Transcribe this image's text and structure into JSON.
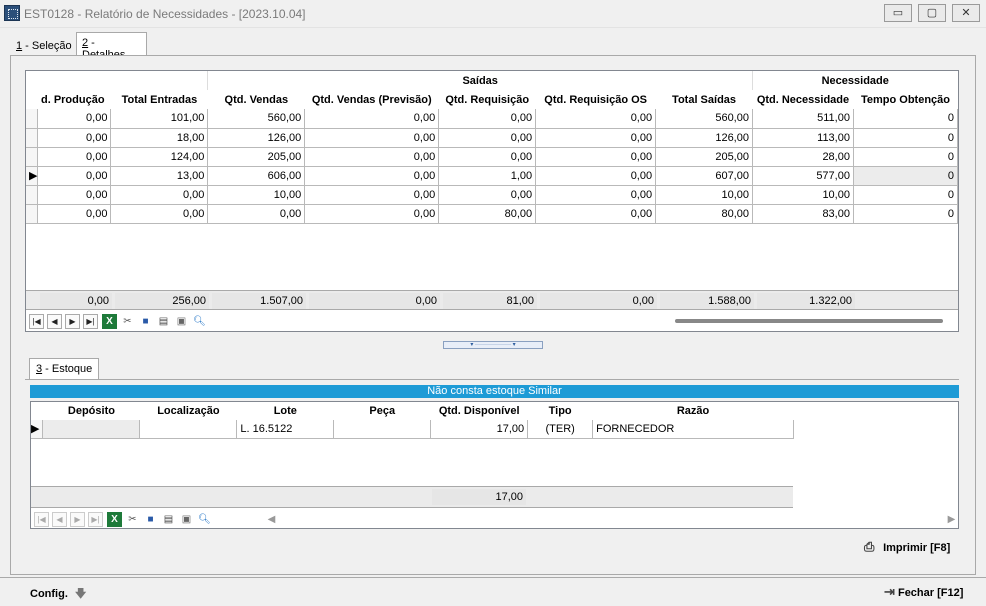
{
  "window": {
    "title": "EST0128 - Relatório de Necessidades - [2023.10.04]",
    "minimize": "▭",
    "maximize": "▢",
    "close": "✕"
  },
  "tabs": [
    {
      "key": "1",
      "label": " - Seleção"
    },
    {
      "key": "2",
      "label": " - Detalhes"
    }
  ],
  "grid1": {
    "group_saidas": "Saídas",
    "group_necessidade": "Necessidade",
    "columns": [
      "d. Produção",
      "Total Entradas",
      "Qtd. Vendas",
      "Qtd. Vendas (Previsão)",
      "Qtd. Requisição",
      "Qtd. Requisição OS",
      "Total Saídas",
      "Qtd. Necessidade",
      "Tempo Obtenção"
    ],
    "rows": [
      [
        "0,00",
        "101,00",
        "560,00",
        "0,00",
        "0,00",
        "0,00",
        "560,00",
        "511,00",
        "0"
      ],
      [
        "0,00",
        "18,00",
        "126,00",
        "0,00",
        "0,00",
        "0,00",
        "126,00",
        "113,00",
        "0"
      ],
      [
        "0,00",
        "124,00",
        "205,00",
        "0,00",
        "0,00",
        "0,00",
        "205,00",
        "28,00",
        "0"
      ],
      [
        "0,00",
        "13,00",
        "606,00",
        "0,00",
        "1,00",
        "0,00",
        "607,00",
        "577,00",
        "0"
      ],
      [
        "0,00",
        "0,00",
        "10,00",
        "0,00",
        "0,00",
        "0,00",
        "10,00",
        "10,00",
        "0"
      ],
      [
        "0,00",
        "0,00",
        "0,00",
        "0,00",
        "80,00",
        "0,00",
        "80,00",
        "83,00",
        "0"
      ]
    ],
    "totals": [
      "0,00",
      "256,00",
      "1.507,00",
      "0,00",
      "81,00",
      "0,00",
      "1.588,00",
      "1.322,00"
    ]
  },
  "tab3": {
    "key": "3",
    "label": " - Estoque"
  },
  "banner": "Não consta estoque Similar",
  "grid2": {
    "columns": [
      "Depósito",
      "Localização",
      "Lote",
      "Peça",
      "Qtd. Disponível",
      "Tipo",
      "Razão"
    ],
    "rows": [
      [
        "",
        "",
        "L. 16.5122",
        "",
        "17,00",
        "(TER)",
        "FORNECEDOR"
      ]
    ],
    "total": "17,00"
  },
  "buttons": {
    "print": "Imprimir [F8]",
    "config": "Config.",
    "close": "Fechar [F12]"
  }
}
